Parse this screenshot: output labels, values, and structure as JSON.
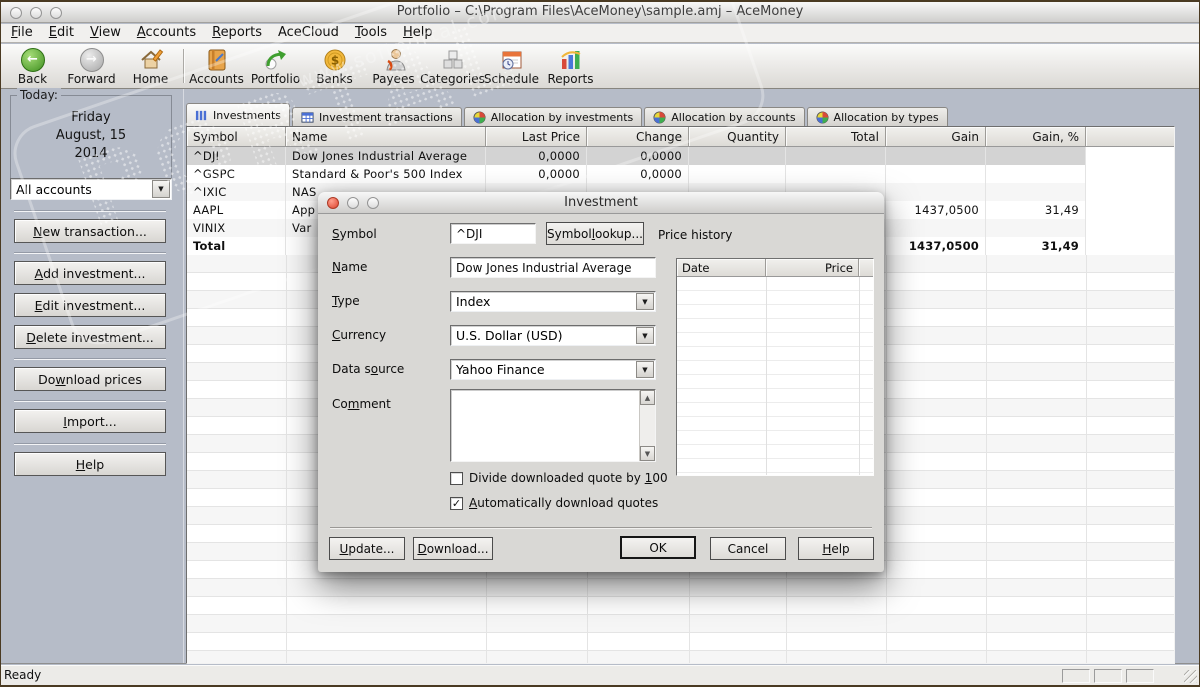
{
  "window": {
    "title": "Portfolio – C:\\Program Files\\AceMoney\\sample.amj – AceMoney"
  },
  "menubar": {
    "items": [
      {
        "t": "File",
        "k": "F"
      },
      {
        "t": "Edit",
        "k": "E"
      },
      {
        "t": "View",
        "k": "V"
      },
      {
        "t": "Accounts",
        "k": "A"
      },
      {
        "t": "Reports",
        "k": "R"
      },
      {
        "t": "AceCloud",
        "k": null
      },
      {
        "t": "Tools",
        "k": "T"
      },
      {
        "t": "Help",
        "k": "H"
      }
    ]
  },
  "toolbar": {
    "items": [
      {
        "label": "Back",
        "icon": "back-icon"
      },
      {
        "label": "Forward",
        "icon": "forward-icon"
      },
      {
        "label": "Home",
        "icon": "home-icon"
      },
      {
        "label": "Accounts",
        "icon": "accounts-icon"
      },
      {
        "label": "Portfolio",
        "icon": "portfolio-icon"
      },
      {
        "label": "Banks",
        "icon": "banks-icon"
      },
      {
        "label": "Payees",
        "icon": "payees-icon"
      },
      {
        "label": "Categories",
        "icon": "categories-icon"
      },
      {
        "label": "Schedule",
        "icon": "schedule-icon"
      },
      {
        "label": "Reports",
        "icon": "reports-icon"
      }
    ]
  },
  "sidebar": {
    "today_label": "Today:",
    "today_lines": [
      "Friday",
      "August, 15",
      "2014"
    ],
    "account_filter": "All accounts",
    "buttons": [
      {
        "t": "New transaction...",
        "k": "N"
      },
      {
        "t": "Add investment...",
        "k": "A"
      },
      {
        "t": "Edit investment...",
        "k": "E"
      },
      {
        "t": "Delete investment...",
        "k": "D"
      },
      {
        "t": "Download prices",
        "k": "w"
      },
      {
        "t": "Import...",
        "k": "I"
      },
      {
        "t": "Help",
        "k": "H"
      }
    ]
  },
  "tabs": [
    {
      "label": "Investments",
      "icon": "bar-chart-icon",
      "active": true
    },
    {
      "label": "Investment transactions",
      "icon": "table-icon",
      "active": false
    },
    {
      "label": "Allocation by investments",
      "icon": "pie-chart-icon",
      "active": false
    },
    {
      "label": "Allocation by accounts",
      "icon": "pie-chart-icon",
      "active": false
    },
    {
      "label": "Allocation by types",
      "icon": "pie-chart-icon",
      "active": false
    }
  ],
  "table": {
    "columns": [
      "Symbol",
      "Name",
      "Last Price",
      "Change",
      "Quantity",
      "Total",
      "Gain",
      "Gain, %",
      ""
    ],
    "rows": [
      {
        "cells": [
          "^DJI",
          "Dow Jones Industrial Average",
          "0,0000",
          "0,0000",
          "",
          "",
          "",
          ""
        ]
      },
      {
        "cells": [
          "^GSPC",
          "Standard & Poor's 500 Index",
          "0,0000",
          "0,0000",
          "",
          "",
          "",
          ""
        ]
      },
      {
        "cells": [
          "^IXIC",
          "NAS",
          "",
          "",
          "",
          "",
          "",
          ""
        ]
      },
      {
        "cells": [
          "AAPL",
          "App",
          "",
          "",
          "",
          "",
          "1437,0500",
          "31,49"
        ]
      },
      {
        "cells": [
          "VINIX",
          "Var",
          "",
          "",
          "",
          "",
          "",
          ""
        ]
      },
      {
        "cells": [
          "Total",
          "",
          "",
          "",
          "",
          "",
          "1437,0500",
          "31,49"
        ]
      }
    ]
  },
  "dialog": {
    "title": "Investment",
    "symbol_label": {
      "t": "Symbol",
      "k": "S"
    },
    "symbol_value": "^DJI",
    "symbol_lookup": {
      "t": "Symbol lookup...",
      "k": "l",
      "occ": 2
    },
    "price_history_label": "Price history",
    "price_history_columns": [
      "Date",
      "Price"
    ],
    "name_label": {
      "t": "Name",
      "k": "N"
    },
    "name_value": "Dow Jones Industrial Average",
    "type_label": {
      "t": "Type",
      "k": "T"
    },
    "type_value": "Index",
    "currency_label": {
      "t": "Currency",
      "k": "C"
    },
    "currency_value": "U.S. Dollar (USD)",
    "datasource_label": {
      "t": "Data source",
      "k": "o"
    },
    "datasource_value": "Yahoo Finance",
    "comment_label": {
      "t": "Comment",
      "k": "m"
    },
    "comment_value": "",
    "checkbox_divide": {
      "t": "Divide downloaded quote by 100",
      "k": "1",
      "checked": false
    },
    "checkbox_auto": {
      "t": "Automatically download quotes",
      "k": "A",
      "checked": true
    },
    "buttons": {
      "update": {
        "t": "Update...",
        "k": "U"
      },
      "download": {
        "t": "Download...",
        "k": "D"
      },
      "ok": {
        "t": "OK",
        "k": null
      },
      "cancel": {
        "t": "Cancel",
        "k": null
      },
      "help": {
        "t": "Help",
        "k": "H"
      }
    }
  },
  "statusbar": {
    "text": "Ready"
  },
  "watermark": {
    "big": "PORTAL",
    "tm": "™",
    "url": "www.softportal.com"
  },
  "colors": {
    "sidebar_bg": "#b6bcc8",
    "content_bg": "#b6bcc8",
    "selected_row": "#d3d3d3",
    "dialog_bg": "#d9d8d5",
    "close_button": "#dd432d",
    "titlebar_top": "#f8f8f8",
    "titlebar_bottom": "#cfcecc"
  }
}
